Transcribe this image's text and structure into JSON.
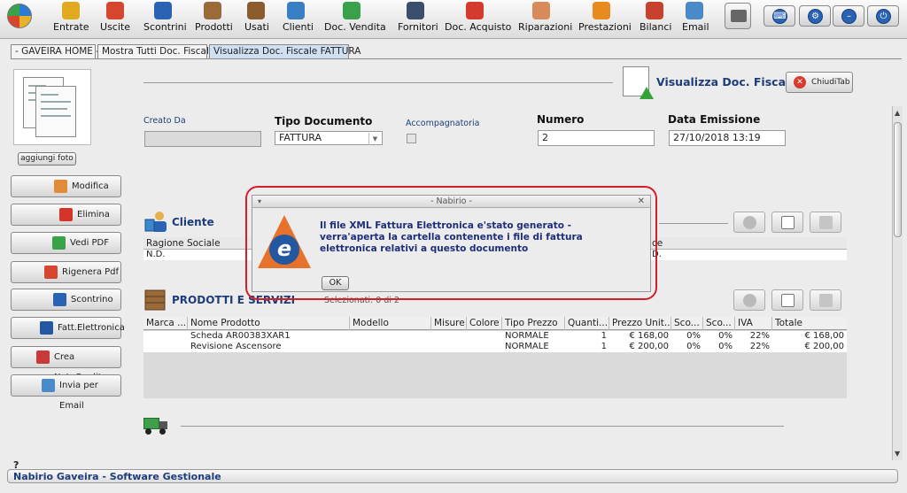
{
  "toolbar": {
    "items": [
      {
        "label": "Entrate",
        "icon": "money-bag-icon",
        "color": "#e0a91e"
      },
      {
        "label": "Uscite",
        "icon": "expense-icon",
        "color": "#d6452e"
      },
      {
        "label": "Scontrini",
        "icon": "receipt-icon",
        "color": "#2a63b3"
      },
      {
        "label": "Prodotti",
        "icon": "box-icon",
        "color": "#9a6a3a"
      },
      {
        "label": "Usati",
        "icon": "used-box-icon",
        "color": "#8a5c2c"
      },
      {
        "label": "Clienti",
        "icon": "customers-icon",
        "color": "#3a7fc1"
      },
      {
        "label": "Doc. Vendita",
        "icon": "sales-doc-icon",
        "color": "#38a14a"
      },
      {
        "label": "Fornitori",
        "icon": "suppliers-icon",
        "color": "#3b4e6e"
      },
      {
        "label": "Doc. Acquisto",
        "icon": "purchase-doc-icon",
        "color": "#d43a2f"
      },
      {
        "label": "Riparazioni",
        "icon": "repair-icon",
        "color": "#d88a5a"
      },
      {
        "label": "Prestazioni",
        "icon": "services-icon",
        "color": "#e88a1e"
      },
      {
        "label": "Bilanci",
        "icon": "balance-icon",
        "color": "#c8402e"
      },
      {
        "label": "Email",
        "icon": "email-icon",
        "color": "#4a8ac8"
      }
    ],
    "right_buttons": [
      {
        "icon": "keyboard-icon",
        "glyph": "⌨"
      },
      {
        "icon": "settings-icon",
        "glyph": "⚙"
      },
      {
        "icon": "minimize-icon",
        "glyph": "–"
      },
      {
        "icon": "power-icon",
        "glyph": "⏻"
      }
    ]
  },
  "tabs": [
    {
      "label": "- GAVEIRA HOME -"
    },
    {
      "label": "Mostra Tutti Doc. Fiscale"
    },
    {
      "label": "Visualizza Doc. Fiscale FATTURA"
    }
  ],
  "page": {
    "title": "Visualizza Doc. Fiscale",
    "close_tab_label": "ChiudiTab",
    "add_photo_label": "aggiungi foto"
  },
  "side_buttons": [
    {
      "label": "Modifica",
      "icon": "edit-icon",
      "color": "#e08a3a"
    },
    {
      "label": "Elimina",
      "icon": "delete-icon",
      "color": "#d6332a"
    },
    {
      "label": "Vedi PDF",
      "icon": "view-pdf-icon",
      "color": "#3aa34a"
    },
    {
      "label": "Rigenera Pdf",
      "icon": "regenerate-pdf-icon",
      "color": "#d6452e"
    },
    {
      "label": "Scontrino",
      "icon": "receipt-icon",
      "color": "#2a63b3"
    },
    {
      "label": "Fatt.Elettronica",
      "icon": "e-invoice-icon",
      "color": "#2357a0"
    },
    {
      "label": "Crea NotaCredito",
      "icon": "credit-note-icon",
      "color": "#c83a3a"
    },
    {
      "label": "Invia per Email",
      "icon": "send-email-icon",
      "color": "#4a8ac8"
    }
  ],
  "form": {
    "creato_da": {
      "label": "Creato Da",
      "value": ""
    },
    "tipo_documento": {
      "label": "Tipo Documento",
      "value": "FATTURA"
    },
    "accompagnatoria": {
      "label": "Accompagnatoria"
    },
    "numero": {
      "label": "Numero",
      "value": "2"
    },
    "data_emissione": {
      "label": "Data Emissione",
      "value": "27/10/2018 13:19"
    }
  },
  "cliente": {
    "title": "Cliente",
    "header": "Ragione Sociale",
    "header_tail": "ce",
    "row": "N.D.",
    "row_tail": "D."
  },
  "prodotti": {
    "title": "PRODOTTI E SERVIZI",
    "selection": "Selezionati:  0 di 2",
    "columns": [
      "Marca ...",
      "Nome Prodotto",
      "Modello",
      "Misure",
      "Colore",
      "Tipo Prezzo",
      "Quanti...",
      "Prezzo Unit...",
      "Sco...",
      "Sco...",
      "IVA",
      "Totale"
    ],
    "rows": [
      {
        "marca": "",
        "nome": "Scheda AR00383XAR1",
        "modello": "",
        "misure": "",
        "colore": "",
        "tipo_prezzo": "NORMALE",
        "quantita": "1",
        "prezzo": "€ 168,00",
        "sconto1": "0%",
        "sconto2": "0%",
        "iva": "22%",
        "totale": "€ 168,00"
      },
      {
        "marca": "",
        "nome": "Revisione Ascensore",
        "modello": "",
        "misure": "",
        "colore": "",
        "tipo_prezzo": "NORMALE",
        "quantita": "1",
        "prezzo": "€ 200,00",
        "sconto1": "0%",
        "sconto2": "0%",
        "iva": "22%",
        "totale": "€ 200,00"
      }
    ]
  },
  "dialog": {
    "title": "- Nabirio -",
    "message": "Il file XML Fattura Elettronica e'stato generato - verra'aperta la cartella contenente i file di fattura elettronica relativi a questo documento",
    "ok_label": "OK",
    "menu_glyph": "▾",
    "close_glyph": "✕"
  },
  "status": {
    "help": "?",
    "text": "Nabirio Gaveira - Software Gestionale"
  }
}
